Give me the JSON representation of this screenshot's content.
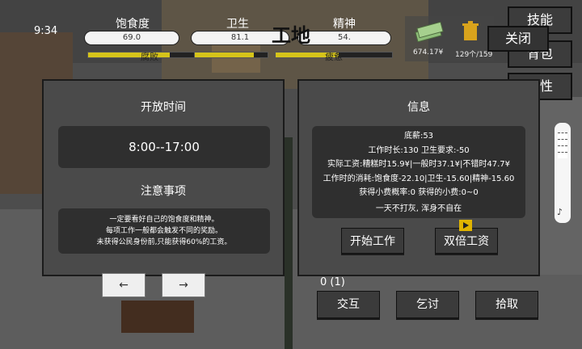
{
  "hud": {
    "time": "9:34",
    "location": "工地",
    "stats": [
      {
        "label": "饱食度",
        "value": "69.0",
        "sub": "腐败",
        "level": 0.69
      },
      {
        "label": "卫生",
        "value": "81.1",
        "sub": "",
        "level": 0.81
      },
      {
        "label": "精神",
        "value": "54.",
        "sub": "疲惫",
        "level": 0.54
      }
    ],
    "money": "674.17¥",
    "capacity": "129个/159",
    "side_buttons": {
      "skills": "技能",
      "bag": "背包",
      "attributes": "属性"
    },
    "close": "关闭"
  },
  "left_panel": {
    "title": "开放时间",
    "hours": "8:00--17:00",
    "notes_title": "注意事项",
    "notes": [
      "一定要看好自己的饱食度和精神。",
      "每项工作一般都会触发不同的奖励。",
      "未获得公民身份前,只能获得60%的工资。"
    ]
  },
  "right_panel": {
    "title": "信息",
    "info_lines": [
      "底薪:53",
      "工作时长:130  卫生要求:-50",
      "实际工资:糟糕时15.9¥|一般时37.1¥|不错时47.7¥",
      "工作时的消耗:饱食度-22.10|卫生-15.60|精神-15.60",
      "获得小费概率:0  获得的小费:0~0",
      "一天不打灰, 浑身不自在"
    ],
    "start_button": "开始工作",
    "double_button": "双倍工资"
  },
  "bottom": {
    "counter": "0 (1)",
    "interact": "交互",
    "beg": "乞讨",
    "pickup": "拾取",
    "left_arrow": "←",
    "right_arrow": "→"
  },
  "colors": {
    "panel": "#4a4a4a",
    "dark_box": "#2f2f2f",
    "bar_fill": "#d6c41a",
    "ad_badge": "#e0b400"
  },
  "icons": [
    "money-stack-icon",
    "trash-can-icon",
    "ad-play-icon",
    "volume-icon"
  ]
}
